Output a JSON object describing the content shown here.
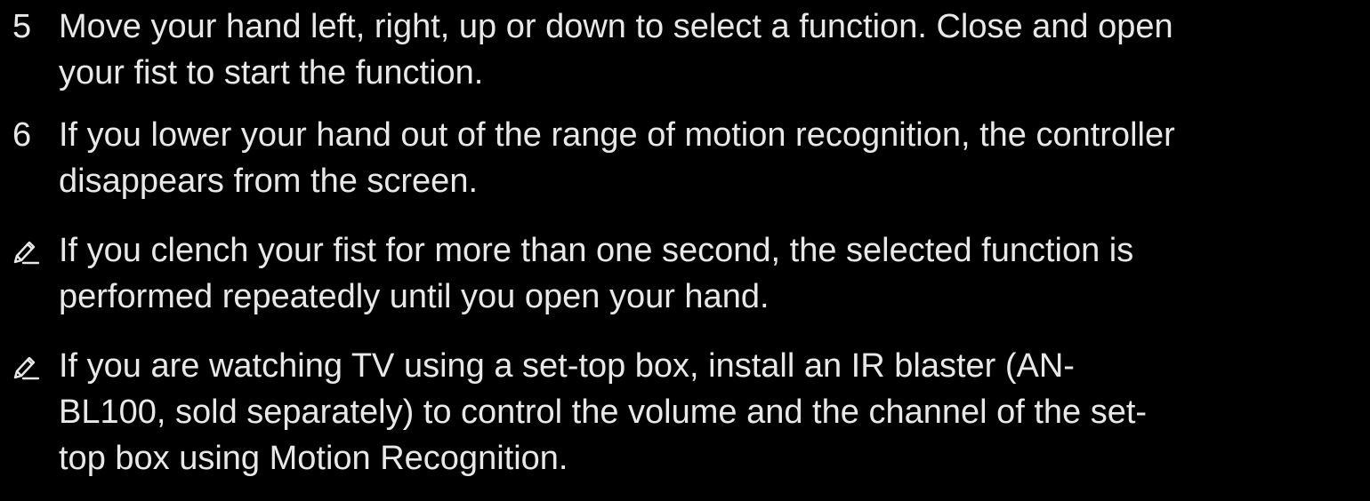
{
  "steps": [
    {
      "number": "5",
      "lines": [
        "Move your hand left, right, up or down to select a function. Close and open",
        "your fist to start the function."
      ]
    },
    {
      "number": "6",
      "lines": [
        "If you lower your hand out of the range of motion recognition, the controller",
        "disappears from the screen."
      ]
    }
  ],
  "notes": [
    {
      "icon": "pencil-note-icon",
      "lines": [
        "If you clench your fist for more than one second, the selected function is",
        "performed repeatedly until you open your hand."
      ]
    },
    {
      "icon": "pencil-note-icon",
      "lines": [
        "If you are watching TV using a set-top box, install an IR blaster (AN-",
        "BL100, sold separately) to control the volume and the channel of the set-",
        "top box using Motion Recognition."
      ]
    }
  ],
  "colors": {
    "background": "#000000",
    "text": "#e8e8e8"
  }
}
